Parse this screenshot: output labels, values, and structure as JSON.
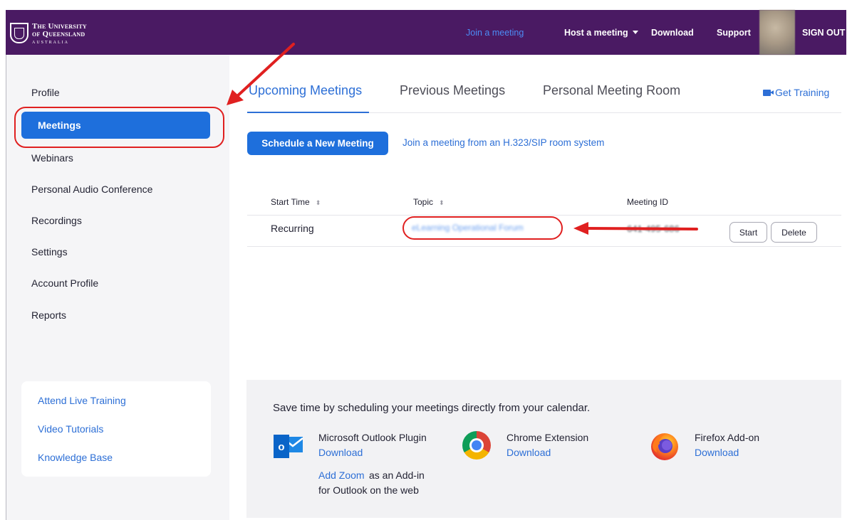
{
  "header": {
    "logo": {
      "line1": "The University",
      "line2": "of Queensland",
      "line3": "AUSTRALIA"
    },
    "nav": {
      "join": "Join a meeting",
      "host": "Host a meeting",
      "download": "Download",
      "support": "Support",
      "sign_out": "SIGN OUT"
    }
  },
  "sidebar": {
    "items": [
      {
        "label": "Profile"
      },
      {
        "label": "Meetings"
      },
      {
        "label": "Webinars"
      },
      {
        "label": "Personal Audio Conference"
      },
      {
        "label": "Recordings"
      },
      {
        "label": "Settings"
      },
      {
        "label": "Account Profile"
      },
      {
        "label": "Reports"
      }
    ],
    "active_index": 1,
    "help_links": [
      "Attend Live Training",
      "Video Tutorials",
      "Knowledge Base"
    ]
  },
  "main": {
    "tabs": [
      "Upcoming Meetings",
      "Previous Meetings",
      "Personal Meeting Room"
    ],
    "active_tab": 0,
    "get_training": "Get Training",
    "schedule_button": "Schedule a New Meeting",
    "join_sip_link": "Join a meeting from an H.323/SIP room system",
    "table": {
      "columns": [
        "Start Time",
        "Topic",
        "Meeting ID"
      ],
      "rows": [
        {
          "start_time": "Recurring",
          "topic": "eLearning Operational Forum",
          "meeting_id": "641-495-686",
          "actions": [
            "Start",
            "Delete"
          ]
        }
      ]
    }
  },
  "banner": {
    "title": "Save time by scheduling your meetings directly from your calendar.",
    "plugins": [
      {
        "name": "Microsoft Outlook Plugin",
        "link": "Download",
        "icon": "outlook-icon"
      },
      {
        "name": "Chrome Extension",
        "link": "Download",
        "icon": "chrome-icon"
      },
      {
        "name": "Firefox Add-on",
        "link": "Download",
        "icon": "firefox-icon"
      }
    ],
    "add_zoom_link": "Add Zoom",
    "add_zoom_text_1": "as an Add-in",
    "add_zoom_text_2": "for Outlook on the web"
  },
  "colors": {
    "header_bg": "#4a1a63",
    "primary": "#1e6fdc",
    "link": "#2d6fd6",
    "annotation": "#e02020"
  }
}
